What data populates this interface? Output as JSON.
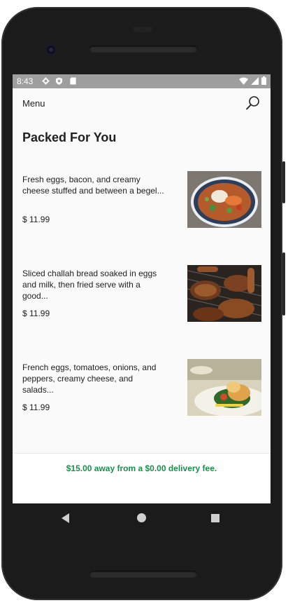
{
  "status_bar": {
    "time": "8:43"
  },
  "app_bar": {
    "menu_label": "Menu"
  },
  "page": {
    "title": "Packed For You"
  },
  "menu_items": [
    {
      "description": "Fresh eggs, bacon, and creamy cheese stuffed and between a begel...",
      "price": "$ 11.99",
      "image": "soup-bowl"
    },
    {
      "description": "Sliced challah bread soaked in eggs and milk, then fried serve with a good...",
      "price": "$ 11.99",
      "image": "grilled-meats"
    },
    {
      "description": "French eggs, tomatoes, onions, and peppers, creamy cheese, and salads...",
      "price": "$ 11.99",
      "image": "plated-salad"
    }
  ],
  "footer": {
    "delivery_message": "$15.00 away from a $0.00 delivery fee."
  },
  "colors": {
    "accent_green": "#1a8f4a",
    "status_bar": "#9e9e9e",
    "screen_bg": "#fafafa"
  }
}
